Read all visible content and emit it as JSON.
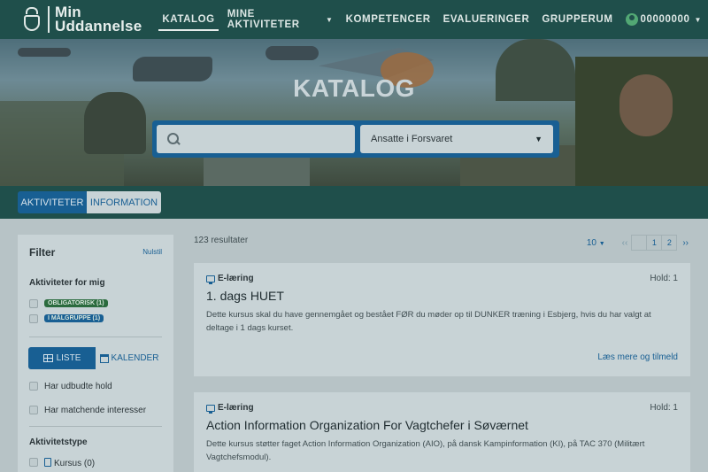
{
  "header": {
    "logo_line1": "Min",
    "logo_line2": "Uddannelse",
    "nav": [
      {
        "label": "KATALOG"
      },
      {
        "label": "MINE AKTIVITETER"
      },
      {
        "label": "KOMPETENCER"
      },
      {
        "label": "EVALUERINGER"
      },
      {
        "label": "GRUPPERUM"
      }
    ],
    "user_id": "00000000"
  },
  "hero": {
    "title": "KATALOG",
    "search_value": "",
    "select_value": "Ansatte i Forsvaret"
  },
  "tabs": [
    {
      "label": "AKTIVITETER"
    },
    {
      "label": "INFORMATION"
    }
  ],
  "filter": {
    "title": "Filter",
    "reset": "Nulstil",
    "section_mine": "Aktiviteter for mig",
    "badge_mandatory": "OBLIGATORISK (1)",
    "badge_target": "I MÅLGRUPPE (1)",
    "view_list": "LISTE",
    "view_calendar": "KALENDER",
    "option_open_hold": "Har udbudte hold",
    "option_interests": "Har matchende interesser",
    "section_type": "Aktivitetstype",
    "option_course": "Kursus (0)"
  },
  "results": {
    "count_text": "123 resultater",
    "page_size": "10",
    "pages": [
      "1",
      "2"
    ],
    "prev": "‹‹",
    "next": "››"
  },
  "cards": [
    {
      "type": "E-læring",
      "hold": "Hold: 1",
      "title": "1. dags HUET",
      "description": "Dette kursus skal du have gennemgået og bestået FØR du møder op til DUNKER træning i Esbjerg, hvis du har valgt at deltage i 1 dags kurset.",
      "link": "Læs mere og tilmeld"
    },
    {
      "type": "E-læring",
      "hold": "Hold: 1",
      "title": "Action Information Organization For Vagtchefer i Søværnet",
      "description": "Dette kursus støtter faget Action Information Organization (AIO), på dansk Kampinformation (KI), på TAC 370 (Militært Vagtchefsmodul)."
    }
  ]
}
